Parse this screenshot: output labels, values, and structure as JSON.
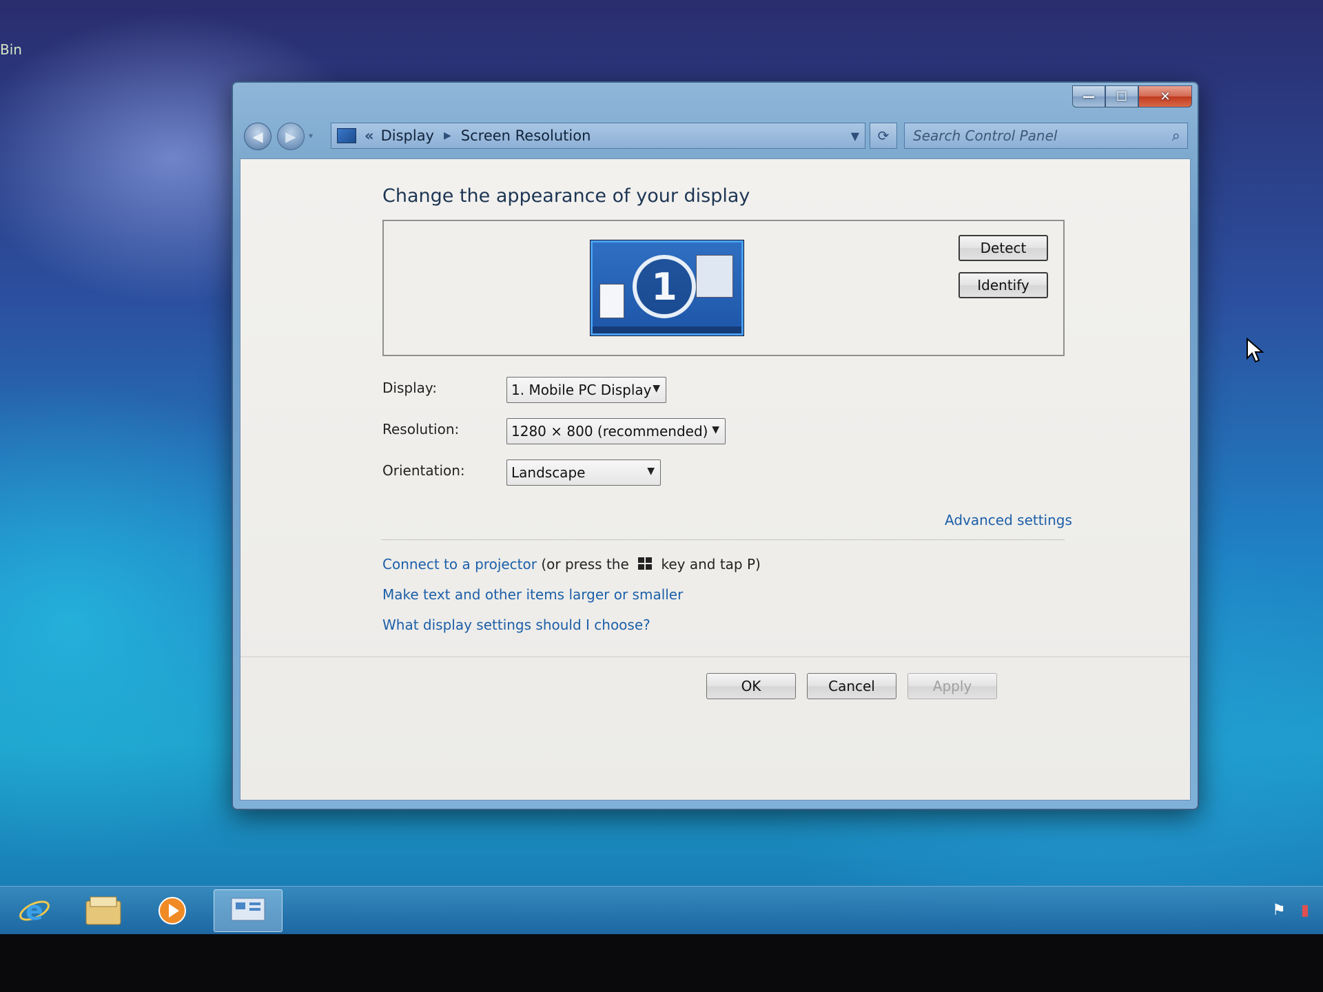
{
  "desktop": {
    "recycle_bin_label": "Bin"
  },
  "window": {
    "address": {
      "crumbs": [
        "Display",
        "Screen Resolution"
      ],
      "prefix": "«"
    },
    "search": {
      "placeholder": "Search Control Panel"
    },
    "caption": {
      "minimize": "—",
      "maximize": "☐",
      "close": "✕"
    }
  },
  "content": {
    "heading": "Change the appearance of your display",
    "monitor_number": "1",
    "detect_label": "Detect",
    "identify_label": "Identify",
    "display": {
      "label": "Display:",
      "value": "1. Mobile PC Display"
    },
    "resolution": {
      "label": "Resolution:",
      "value": "1280 × 800 (recommended)"
    },
    "orientation": {
      "label": "Orientation:",
      "value": "Landscape"
    },
    "advanced_settings": "Advanced settings",
    "projector_link": "Connect to a projector",
    "projector_text_before": "(or press the",
    "projector_text_after": "key and tap P)",
    "text_size_link": "Make text and other items larger or smaller",
    "help_link": "What display settings should I choose?",
    "ok_label": "OK",
    "cancel_label": "Cancel",
    "apply_label": "Apply"
  },
  "taskbar": {
    "items": [
      "internet-explorer",
      "windows-explorer",
      "media-player",
      "control-panel"
    ]
  },
  "colors": {
    "link": "#1c5fa8",
    "heading": "#1d3553"
  }
}
